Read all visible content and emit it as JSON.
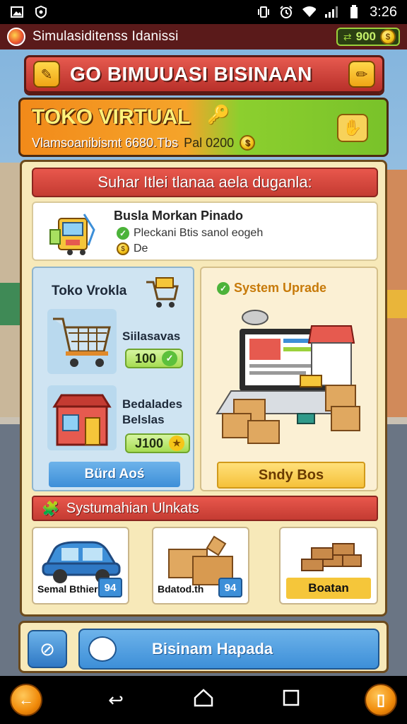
{
  "statusbar": {
    "time": "3:26"
  },
  "app": {
    "title": "Simulasiditenss Idanissi",
    "coins": "900"
  },
  "banner": {
    "title": "GO BIMUUASI BISINAAN"
  },
  "toko": {
    "name": "TOKO VIRTUAL",
    "subtitle": "Vlamsoanibismt 6680.Tbs",
    "balance": "Pal 0200"
  },
  "mission": {
    "header": "Suhar Itlei tlanaa aela duganla:",
    "title": "Busla Morkan Pinado",
    "row1": "Pleckani Btis sanol eogeh",
    "row2": "De"
  },
  "shop": {
    "title": "Toko Vrokla",
    "items": [
      {
        "name": "Siilasavas",
        "price": "100"
      },
      {
        "name": "Bedalades Belslas",
        "price": "J100"
      }
    ],
    "button": "Bürd Aoś"
  },
  "upgrade": {
    "title": "System Uprade",
    "button": "Sndy Bos"
  },
  "system": {
    "header": "Systumahian Ulnkats",
    "cards": [
      {
        "label": "Semal Bthiern",
        "num": "94"
      },
      {
        "label": "Bdatod.th",
        "num": "94"
      },
      {
        "label": "Boatan"
      }
    ]
  },
  "action": {
    "button": "Bisinam Hapada"
  },
  "colors": {
    "red": "#c43b32",
    "blue": "#3d8fd8",
    "green": "#79c22a",
    "orange": "#f28a1a",
    "yellow": "#f5c63a"
  }
}
